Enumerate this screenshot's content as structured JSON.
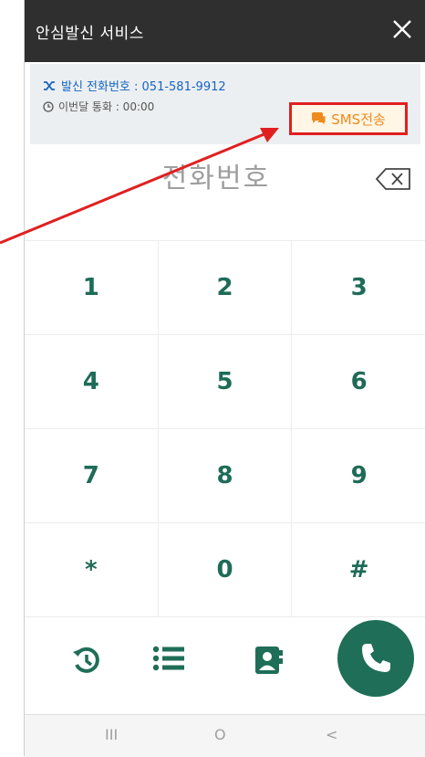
{
  "header": {
    "title": "안심발신 서비스"
  },
  "info": {
    "caller_number_label": "발신 전화번호 : 051-581-9912",
    "monthly_call_label": "이번달 통화 : 00:00"
  },
  "sms_button": {
    "label": "SMS전송"
  },
  "dial": {
    "placeholder": "전화번호"
  },
  "keypad": {
    "k1": "1",
    "k2": "2",
    "k3": "3",
    "k4": "4",
    "k5": "5",
    "k6": "6",
    "k7": "7",
    "k8": "8",
    "k9": "9",
    "kstar": "*",
    "k0": "0",
    "khash": "#"
  },
  "navbar": {
    "recent": "III",
    "home": "O",
    "back": "<"
  },
  "colors": {
    "accent_green": "#1f6e57",
    "highlight_red": "#e02020",
    "sms_orange": "#ef8a1c",
    "link_blue": "#1565c0",
    "titlebar": "#2f2f2f"
  },
  "icons": {
    "close": "close-icon",
    "shuffle": "shuffle-icon",
    "clock": "clock-icon",
    "chat": "chat-bubble-icon",
    "backspace": "backspace-icon",
    "history": "history-icon",
    "list": "list-icon",
    "contacts": "contact-book-icon",
    "phone": "phone-icon"
  }
}
